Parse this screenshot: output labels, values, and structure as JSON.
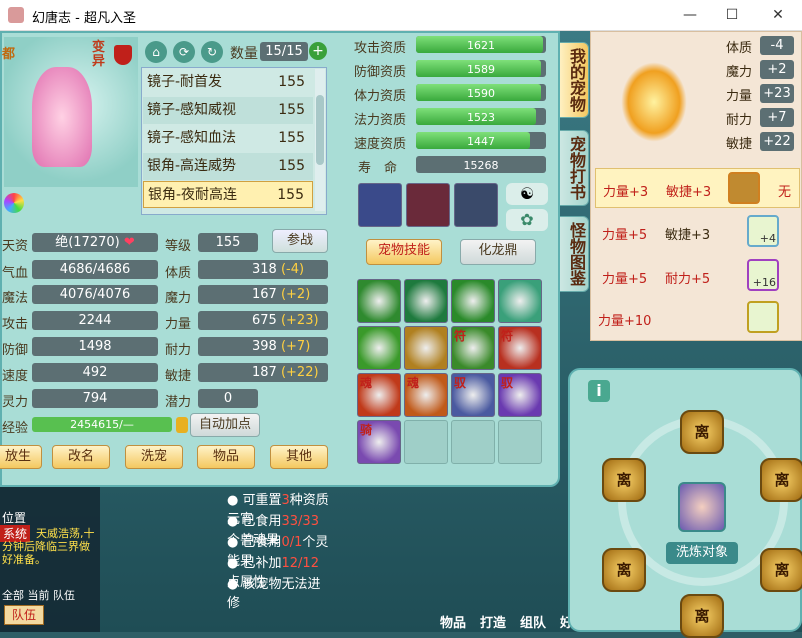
{
  "window": {
    "title": "幻唐志 - 超凡入圣",
    "min": "—",
    "max": "☐",
    "close": "✕"
  },
  "header": {
    "qty_label": "数量",
    "qty_value": "15/15",
    "plus": "+",
    "side_a": "都",
    "side_b": "变异"
  },
  "pet_list": [
    {
      "name": "镜子-耐首发",
      "level": "155"
    },
    {
      "name": "镜子-感知威视",
      "level": "155"
    },
    {
      "name": "镜子-感知血法",
      "level": "155"
    },
    {
      "name": "银角-高连威势",
      "level": "155"
    },
    {
      "name": "银角-夜耐高连",
      "level": "155"
    }
  ],
  "stats": {
    "tianzi_label": "天资",
    "tianzi_value": "绝(17270)",
    "hp_label": "气血",
    "hp_value": "4686/4686",
    "mp_label": "魔法",
    "mp_value": "4076/4076",
    "atk_label": "攻击",
    "atk_value": "2244",
    "def_label": "防御",
    "def_value": "1498",
    "spd_label": "速度",
    "spd_value": "492",
    "ling_label": "灵力",
    "ling_value": "794",
    "exp_label": "经验",
    "exp_value": "2454615/—",
    "level_label": "等级",
    "level_value": "155",
    "fight_button": "参战",
    "tizhi_label": "体质",
    "tizhi_value": "318",
    "tizhi_bonus": "(-4)",
    "moli_label": "魔力",
    "moli_value": "167",
    "moli_bonus": "(+2)",
    "liliang_label": "力量",
    "liliang_value": "675",
    "liliang_bonus": "(+23)",
    "naili_label": "耐力",
    "naili_value": "398",
    "naili_bonus": "(+7)",
    "minjie_label": "敏捷",
    "minjie_value": "187",
    "minjie_bonus": "(+22)",
    "qianli_label": "潜力",
    "qianli_value": "0",
    "auto_button": "自动加点"
  },
  "aptitude": [
    {
      "label": "攻击资质",
      "value": "1621",
      "fill": 0.98
    },
    {
      "label": "防御资质",
      "value": "1589",
      "fill": 0.96
    },
    {
      "label": "体力资质",
      "value": "1590",
      "fill": 0.96
    },
    {
      "label": "法力资质",
      "value": "1523",
      "fill": 0.92
    },
    {
      "label": "速度资质",
      "value": "1447",
      "fill": 0.88
    },
    {
      "label": "寿　命",
      "value": "15268",
      "fill": 1
    }
  ],
  "tabs": {
    "skills": "宠物技能",
    "hualong": "化龙鼎"
  },
  "skills": [
    {
      "glyph": "",
      "c": "#2f8a2f"
    },
    {
      "glyph": "",
      "c": "#1e7a3e"
    },
    {
      "glyph": "",
      "c": "#2a8a2a"
    },
    {
      "glyph": "",
      "c": "#3aa07a"
    },
    {
      "glyph": "",
      "c": "#3a9a2a"
    },
    {
      "glyph": "",
      "c": "#b08020"
    },
    {
      "glyph": "符",
      "c": "#3a8a2a"
    },
    {
      "glyph": "符",
      "c": "#b83020"
    },
    {
      "glyph": "魂",
      "c": "#c03a1a"
    },
    {
      "glyph": "魂",
      "c": "#c05a1a"
    },
    {
      "glyph": "驭",
      "c": "#4a5aa0"
    },
    {
      "glyph": "驭",
      "c": "#6a3ab0"
    },
    {
      "glyph": "骑",
      "c": "#7a4ab0"
    }
  ],
  "bottom_buttons": [
    "放生",
    "改名",
    "洗宠",
    "物品",
    "其他"
  ],
  "vtabs": [
    "我的宠物",
    "宠物打书",
    "怪物图鉴"
  ],
  "attr_right": [
    {
      "label": "体质",
      "value": "-4"
    },
    {
      "label": "魔力",
      "value": "+2"
    },
    {
      "label": "力量",
      "value": "+23"
    },
    {
      "label": "耐力",
      "value": "+7"
    },
    {
      "label": "敏捷",
      "value": "+22"
    }
  ],
  "equip_rows": [
    {
      "a": "力量+3",
      "b": "敏捷+3",
      "tail": "无"
    },
    {
      "a": "力量+5",
      "b": "敏捷+3",
      "badge": "+4"
    },
    {
      "a": "力量+5",
      "b": "耐力+5",
      "badge": "+16"
    },
    {
      "a": "力量+10",
      "b": ""
    }
  ],
  "info_lines": [
    {
      "pre": "可重置",
      "hl": "3",
      "post": "种资质元宵"
    },
    {
      "pre": "已食用",
      "hl": "33/33",
      "post": "个兽魂果"
    },
    {
      "pre": "已食用",
      "hl": "0/1",
      "post": "个灵能果"
    },
    {
      "pre": "已补加",
      "hl": "12/12",
      "post": "点属性"
    },
    {
      "pre": "该宠物无法进修",
      "hl": "",
      "post": ""
    }
  ],
  "chat": {
    "pos": "位置",
    "sys": "系统",
    "msg": "天威浩荡,十分钟后降临三界做好准备。",
    "tabs": [
      "全部",
      "当前",
      "队伍"
    ],
    "team": "队伍"
  },
  "wheel": {
    "label": "洗炼对象",
    "slot": "离"
  },
  "bottom_bar": [
    "物品",
    "打造",
    "组队",
    "好友"
  ],
  "info_icon": "i"
}
